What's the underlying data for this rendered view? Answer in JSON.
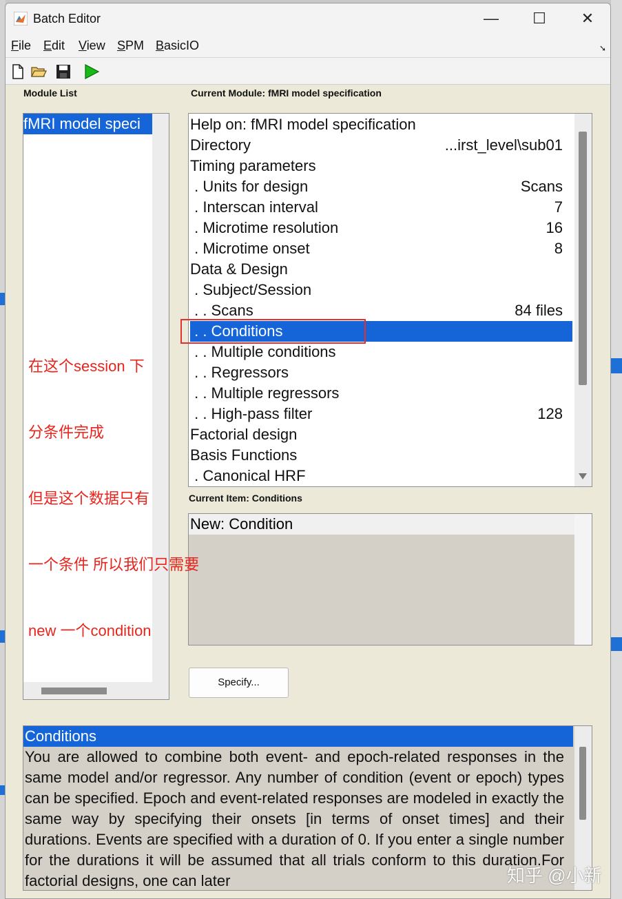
{
  "window": {
    "title": "Batch Editor"
  },
  "window_controls": {
    "minimize": "—",
    "maximize": "☐",
    "close": "✕"
  },
  "menu": [
    {
      "accel": "F",
      "rest": "ile"
    },
    {
      "accel": "E",
      "rest": "dit"
    },
    {
      "accel": "V",
      "rest": "iew"
    },
    {
      "accel": "S",
      "rest": "PM"
    },
    {
      "accel": "B",
      "rest": "asicIO"
    }
  ],
  "toolbar": [
    "new-file-icon",
    "open-folder-icon",
    "save-icon",
    "run-icon"
  ],
  "module_list": {
    "label": "Module List",
    "items": [
      "fMRI model speci"
    ]
  },
  "current_module": {
    "label": "Current Module: fMRI model specification",
    "rows": [
      {
        "name": "Help on: fMRI model specification",
        "value": ""
      },
      {
        "name": "Directory",
        "value": "...irst_level\\sub01"
      },
      {
        "name": "Timing parameters",
        "value": ""
      },
      {
        "name": " . Units for design",
        "value": "Scans"
      },
      {
        "name": " . Interscan interval",
        "value": "7"
      },
      {
        "name": " . Microtime resolution",
        "value": "16"
      },
      {
        "name": " . Microtime onset",
        "value": "8"
      },
      {
        "name": "Data & Design",
        "value": ""
      },
      {
        "name": " . Subject/Session",
        "value": ""
      },
      {
        "name": " . . Scans",
        "value": "84 files"
      },
      {
        "name": " . . Conditions",
        "value": ""
      },
      {
        "name": " . . Multiple conditions",
        "value": ""
      },
      {
        "name": " . . Regressors",
        "value": ""
      },
      {
        "name": " . . Multiple regressors",
        "value": ""
      },
      {
        "name": " . . High-pass filter",
        "value": "128"
      },
      {
        "name": "Factorial design",
        "value": ""
      },
      {
        "name": "Basis Functions",
        "value": ""
      },
      {
        "name": " . Canonical HRF",
        "value": ""
      }
    ],
    "selected_index": 10
  },
  "current_item": {
    "label": "Current Item: Conditions",
    "items": [
      "New: Condition"
    ]
  },
  "specify_button": "Specify...",
  "help": {
    "title": "Conditions",
    "text": "You are allowed to combine both event- and epoch-related responses in the same model and/or regressor. Any number of condition (event or epoch) types can be specified. Epoch and event-related responses are modeled in exactly the same way by specifying their onsets [in terms of onset times] and their durations. Events are specified with a duration of 0. If you enter a single number for the durations it will be assumed that all trials conform to this duration.For factorial designs, one can later"
  },
  "annotation": {
    "lines": [
      "在这个session 下",
      "分条件完成",
      "但是这个数据只有",
      "一个条件 所以我们只需要",
      "new 一个condition"
    ]
  },
  "watermark": "知乎 @小新"
}
